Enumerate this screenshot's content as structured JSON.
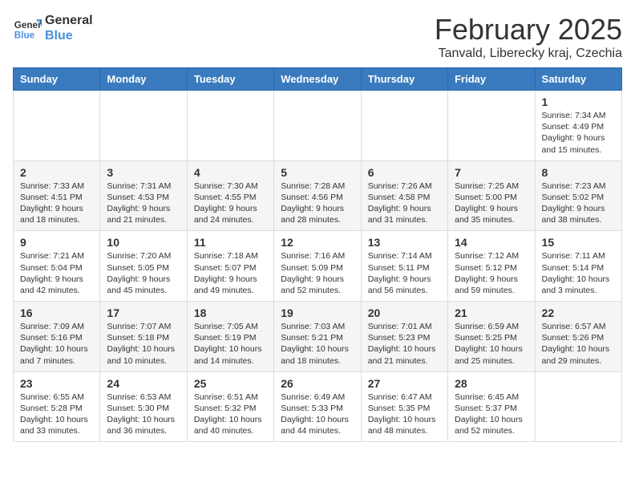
{
  "header": {
    "logo_line1": "General",
    "logo_line2": "Blue",
    "title": "February 2025",
    "subtitle": "Tanvald, Liberecky kraj, Czechia"
  },
  "columns": [
    "Sunday",
    "Monday",
    "Tuesday",
    "Wednesday",
    "Thursday",
    "Friday",
    "Saturday"
  ],
  "weeks": [
    [
      {
        "day": "",
        "content": ""
      },
      {
        "day": "",
        "content": ""
      },
      {
        "day": "",
        "content": ""
      },
      {
        "day": "",
        "content": ""
      },
      {
        "day": "",
        "content": ""
      },
      {
        "day": "",
        "content": ""
      },
      {
        "day": "1",
        "content": "Sunrise: 7:34 AM\nSunset: 4:49 PM\nDaylight: 9 hours and 15 minutes."
      }
    ],
    [
      {
        "day": "2",
        "content": "Sunrise: 7:33 AM\nSunset: 4:51 PM\nDaylight: 9 hours and 18 minutes."
      },
      {
        "day": "3",
        "content": "Sunrise: 7:31 AM\nSunset: 4:53 PM\nDaylight: 9 hours and 21 minutes."
      },
      {
        "day": "4",
        "content": "Sunrise: 7:30 AM\nSunset: 4:55 PM\nDaylight: 9 hours and 24 minutes."
      },
      {
        "day": "5",
        "content": "Sunrise: 7:28 AM\nSunset: 4:56 PM\nDaylight: 9 hours and 28 minutes."
      },
      {
        "day": "6",
        "content": "Sunrise: 7:26 AM\nSunset: 4:58 PM\nDaylight: 9 hours and 31 minutes."
      },
      {
        "day": "7",
        "content": "Sunrise: 7:25 AM\nSunset: 5:00 PM\nDaylight: 9 hours and 35 minutes."
      },
      {
        "day": "8",
        "content": "Sunrise: 7:23 AM\nSunset: 5:02 PM\nDaylight: 9 hours and 38 minutes."
      }
    ],
    [
      {
        "day": "9",
        "content": "Sunrise: 7:21 AM\nSunset: 5:04 PM\nDaylight: 9 hours and 42 minutes."
      },
      {
        "day": "10",
        "content": "Sunrise: 7:20 AM\nSunset: 5:05 PM\nDaylight: 9 hours and 45 minutes."
      },
      {
        "day": "11",
        "content": "Sunrise: 7:18 AM\nSunset: 5:07 PM\nDaylight: 9 hours and 49 minutes."
      },
      {
        "day": "12",
        "content": "Sunrise: 7:16 AM\nSunset: 5:09 PM\nDaylight: 9 hours and 52 minutes."
      },
      {
        "day": "13",
        "content": "Sunrise: 7:14 AM\nSunset: 5:11 PM\nDaylight: 9 hours and 56 minutes."
      },
      {
        "day": "14",
        "content": "Sunrise: 7:12 AM\nSunset: 5:12 PM\nDaylight: 9 hours and 59 minutes."
      },
      {
        "day": "15",
        "content": "Sunrise: 7:11 AM\nSunset: 5:14 PM\nDaylight: 10 hours and 3 minutes."
      }
    ],
    [
      {
        "day": "16",
        "content": "Sunrise: 7:09 AM\nSunset: 5:16 PM\nDaylight: 10 hours and 7 minutes."
      },
      {
        "day": "17",
        "content": "Sunrise: 7:07 AM\nSunset: 5:18 PM\nDaylight: 10 hours and 10 minutes."
      },
      {
        "day": "18",
        "content": "Sunrise: 7:05 AM\nSunset: 5:19 PM\nDaylight: 10 hours and 14 minutes."
      },
      {
        "day": "19",
        "content": "Sunrise: 7:03 AM\nSunset: 5:21 PM\nDaylight: 10 hours and 18 minutes."
      },
      {
        "day": "20",
        "content": "Sunrise: 7:01 AM\nSunset: 5:23 PM\nDaylight: 10 hours and 21 minutes."
      },
      {
        "day": "21",
        "content": "Sunrise: 6:59 AM\nSunset: 5:25 PM\nDaylight: 10 hours and 25 minutes."
      },
      {
        "day": "22",
        "content": "Sunrise: 6:57 AM\nSunset: 5:26 PM\nDaylight: 10 hours and 29 minutes."
      }
    ],
    [
      {
        "day": "23",
        "content": "Sunrise: 6:55 AM\nSunset: 5:28 PM\nDaylight: 10 hours and 33 minutes."
      },
      {
        "day": "24",
        "content": "Sunrise: 6:53 AM\nSunset: 5:30 PM\nDaylight: 10 hours and 36 minutes."
      },
      {
        "day": "25",
        "content": "Sunrise: 6:51 AM\nSunset: 5:32 PM\nDaylight: 10 hours and 40 minutes."
      },
      {
        "day": "26",
        "content": "Sunrise: 6:49 AM\nSunset: 5:33 PM\nDaylight: 10 hours and 44 minutes."
      },
      {
        "day": "27",
        "content": "Sunrise: 6:47 AM\nSunset: 5:35 PM\nDaylight: 10 hours and 48 minutes."
      },
      {
        "day": "28",
        "content": "Sunrise: 6:45 AM\nSunset: 5:37 PM\nDaylight: 10 hours and 52 minutes."
      },
      {
        "day": "",
        "content": ""
      }
    ]
  ]
}
